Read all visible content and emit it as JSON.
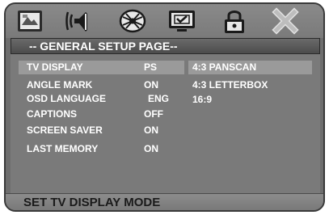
{
  "toolbar": {
    "icons": [
      {
        "name": "general-setup-icon"
      },
      {
        "name": "audio-setup-icon"
      },
      {
        "name": "video-setup-icon"
      },
      {
        "name": "preference-icon"
      },
      {
        "name": "password-lock-icon"
      },
      {
        "name": "exit-icon"
      }
    ]
  },
  "title": "-- GENERAL SETUP PAGE--",
  "settings": [
    {
      "label": "TV DISPLAY",
      "value": "PS",
      "selected": true
    },
    {
      "label": "ANGLE MARK",
      "value": "ON",
      "selected": false
    },
    {
      "label": "OSD LANGUAGE",
      "value": "ENG",
      "selected": false
    },
    {
      "label": "CAPTIONS",
      "value": "OFF",
      "selected": false
    },
    {
      "label": "SCREEN SAVER",
      "value": "ON",
      "selected": false
    },
    {
      "label": "LAST MEMORY",
      "value": "ON",
      "selected": false
    }
  ],
  "options": [
    {
      "label": "4:3 PANSCAN",
      "selected": true
    },
    {
      "label": "4:3 LETTERBOX",
      "selected": false
    },
    {
      "label": "16:9",
      "selected": false
    }
  ],
  "status": "SET TV DISPLAY MODE",
  "colors": {
    "background": "#6e6e6e",
    "highlight": "#9a9a9a",
    "text": "#ffffff"
  }
}
